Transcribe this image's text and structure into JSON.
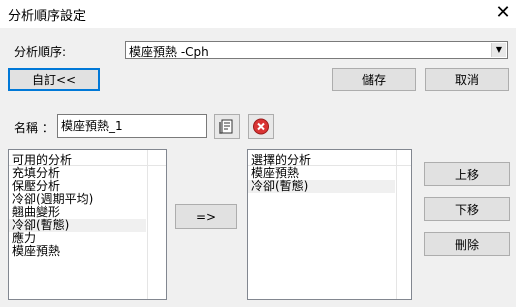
{
  "window": {
    "title": "分析順序設定",
    "close_glyph": "✕"
  },
  "order": {
    "label": "分析順序:",
    "selected": "模座預熱 -Cph",
    "arrow_glyph": "▼"
  },
  "buttons": {
    "custom": "自訂<<",
    "save": "儲存",
    "cancel": "取消",
    "add": "=>",
    "move_up": "上移",
    "move_down": "下移",
    "delete": "刪除"
  },
  "name": {
    "label": "名稱 ：",
    "value": "模座預熱_1"
  },
  "icons": {
    "name_action": "document-edit-icon",
    "name_remove": "red-circle-x-icon"
  },
  "available": {
    "header": "可用的分析",
    "items": [
      "充填分析",
      "保壓分析",
      "冷卻(週期平均)",
      "翹曲變形",
      "冷卻(暫態)",
      "應力",
      "模座預熱"
    ],
    "selected_index": 4
  },
  "chosen": {
    "header": "選擇的分析",
    "items": [
      "模座預熱",
      "冷卻(暫態)"
    ],
    "selected_index": 1
  },
  "colors": {
    "accent": "#0078d7",
    "selection": "#f0f0f0",
    "delete_red": "#d93434"
  }
}
